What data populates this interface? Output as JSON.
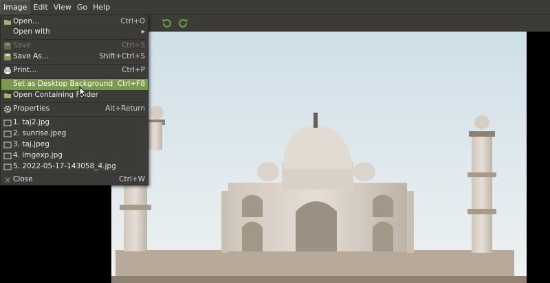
{
  "menubar": {
    "items": [
      "Image",
      "Edit",
      "View",
      "Go",
      "Help"
    ]
  },
  "toolbar": {
    "buttons": [
      "rotate-left-icon",
      "rotate-right-icon"
    ],
    "accent": "#6aa837"
  },
  "image_menu": {
    "open": {
      "label": "Open...",
      "shortcut": "Ctrl+O"
    },
    "open_with": {
      "label": "Open with"
    },
    "save": {
      "label": "Save",
      "shortcut": "Ctrl+S"
    },
    "save_as": {
      "label": "Save As...",
      "shortcut": "Shift+Ctrl+S"
    },
    "print": {
      "label": "Print...",
      "shortcut": "Ctrl+P"
    },
    "set_background": {
      "label": "Set as Desktop Background",
      "shortcut": "Ctrl+F8"
    },
    "open_folder": {
      "label": "Open Containing Folder"
    },
    "properties": {
      "label": "Properties",
      "shortcut": "Alt+Return"
    },
    "recent": [
      "1. taj2.jpg",
      "2. sunrise.jpeg",
      "3. taj.jpeg",
      "4. imgexp.jpg",
      "5. 2022-05-17-143058_4.jpg"
    ],
    "close": {
      "label": "Close",
      "shortcut": "Ctrl+W"
    }
  },
  "colors": {
    "menu_bg": "#3c3b37",
    "highlight": "#7b9a50",
    "disabled_text": "#7d7c77"
  }
}
